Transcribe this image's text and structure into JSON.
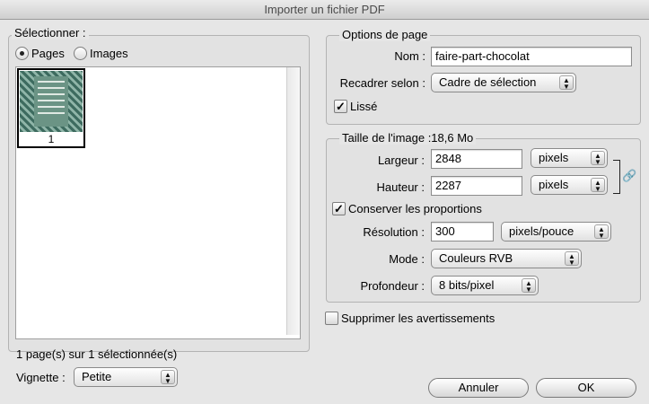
{
  "window": {
    "title": "Importer un fichier PDF"
  },
  "select_group": {
    "legend": "Sélectionner :",
    "radio_pages": "Pages",
    "radio_images": "Images",
    "selected_radio": "Pages",
    "thumbnails": [
      {
        "label": "1",
        "selected": true
      }
    ],
    "status": "1 page(s) sur 1 sélectionnée(s)",
    "vignette_label": "Vignette :",
    "vignette_value": "Petite"
  },
  "page_options": {
    "legend": "Options de page",
    "nom_label": "Nom :",
    "nom_value": "faire-part-chocolat",
    "recadrer_label": "Recadrer selon :",
    "recadrer_value": "Cadre de sélection",
    "lisse_label": "Lissé",
    "lisse_checked": true
  },
  "image_size": {
    "legend": "Taille de l'image :18,6 Mo",
    "largeur_label": "Largeur :",
    "largeur_value": "2848",
    "largeur_unit": "pixels",
    "hauteur_label": "Hauteur :",
    "hauteur_value": "2287",
    "hauteur_unit": "pixels",
    "conserver_label": "Conserver les proportions",
    "conserver_checked": true,
    "resolution_label": "Résolution :",
    "resolution_value": "300",
    "resolution_unit": "pixels/pouce",
    "mode_label": "Mode :",
    "mode_value": "Couleurs RVB",
    "profondeur_label": "Profondeur :",
    "profondeur_value": "8 bits/pixel"
  },
  "suppress": {
    "label": "Supprimer les avertissements",
    "checked": false
  },
  "buttons": {
    "cancel": "Annuler",
    "ok": "OK"
  },
  "icons": {
    "link": "chain-link-icon",
    "popup_arrows": "updown-arrows-icon",
    "check": "checkmark-icon"
  }
}
